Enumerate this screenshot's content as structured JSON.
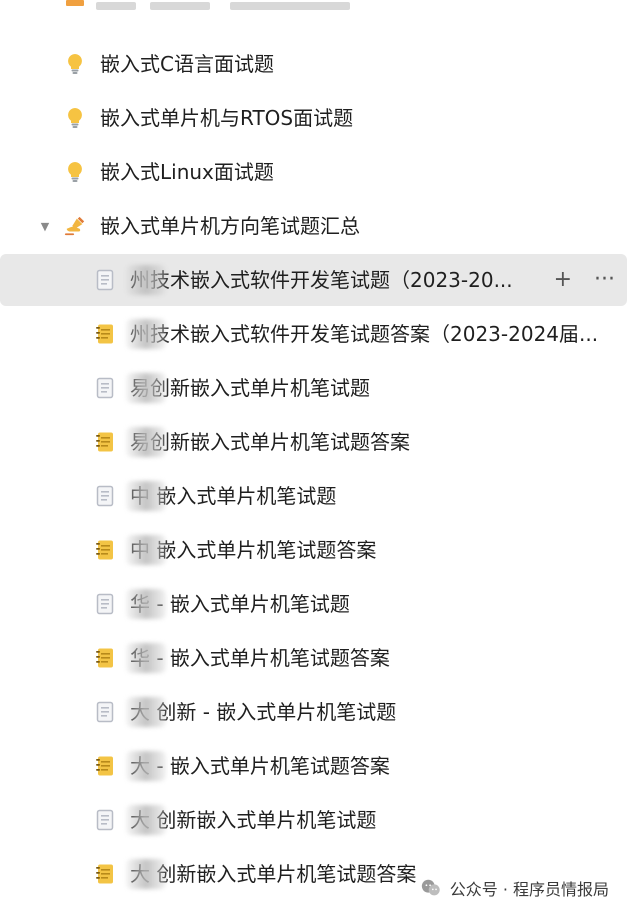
{
  "colors": {
    "hover_bg": "#e8e8e8",
    "bulb": "#f6c342",
    "doc_gray": "#b8bcc6",
    "note_yellow": "#f3c445",
    "text": "#1f1f1f"
  },
  "tree": {
    "items": [
      {
        "label": "嵌入式C语言面试题",
        "icon": "bulb-icon",
        "level": 1
      },
      {
        "label": "嵌入式单片机与RTOS面试题",
        "icon": "bulb-icon",
        "level": 1
      },
      {
        "label": "嵌入式Linux面试题",
        "icon": "bulb-icon",
        "level": 1
      },
      {
        "label": "嵌入式单片机方向笔试题汇总",
        "icon": "writing-hand-icon",
        "level": 1,
        "expanded": true,
        "expander": "▼"
      },
      {
        "label": "州技术嵌入式软件开发笔试题（2023-20...",
        "icon": "document-icon",
        "level": 2,
        "hovered": true
      },
      {
        "label": "州技术嵌入式软件开发笔试题答案（2023-2024届...",
        "icon": "notebook-icon",
        "level": 2
      },
      {
        "label": "易创新嵌入式单片机笔试题",
        "icon": "document-icon",
        "level": 2
      },
      {
        "label": "易创新嵌入式单片机笔试题答案",
        "icon": "notebook-icon",
        "level": 2
      },
      {
        "label": "中 嵌入式单片机笔试题",
        "icon": "document-icon",
        "level": 2
      },
      {
        "label": "中 嵌入式单片机笔试题答案",
        "icon": "notebook-icon",
        "level": 2
      },
      {
        "label": "华  - 嵌入式单片机笔试题",
        "icon": "document-icon",
        "level": 2
      },
      {
        "label": "华  - 嵌入式单片机笔试题答案",
        "icon": "notebook-icon",
        "level": 2
      },
      {
        "label": "大  创新 - 嵌入式单片机笔试题",
        "icon": "document-icon",
        "level": 2
      },
      {
        "label": "大  - 嵌入式单片机笔试题答案",
        "icon": "notebook-icon",
        "level": 2
      },
      {
        "label": "大  创新嵌入式单片机笔试题",
        "icon": "document-icon",
        "level": 2
      },
      {
        "label": "大  创新嵌入式单片机笔试题答案",
        "icon": "notebook-icon",
        "level": 2
      }
    ],
    "hover_actions": {
      "add": "+",
      "more": "···"
    }
  },
  "watermark": {
    "text": "公众号 · 程序员情报局",
    "icon": "wechat-icon"
  }
}
